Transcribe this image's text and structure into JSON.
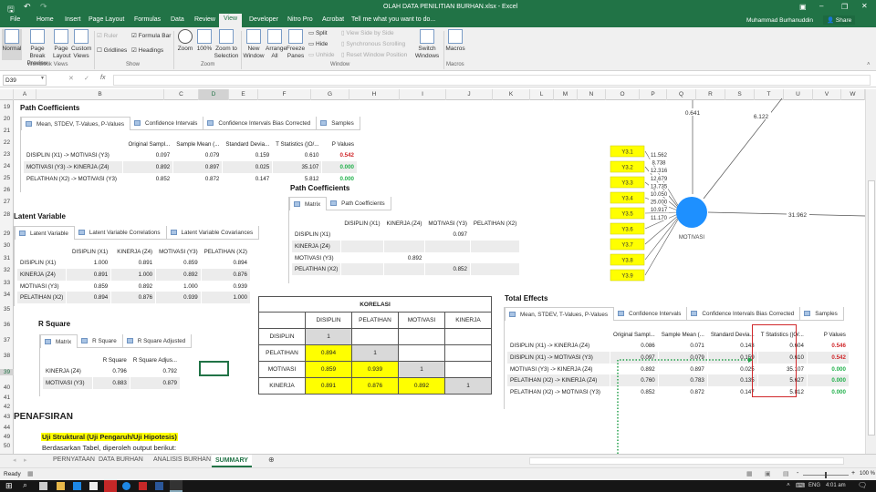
{
  "title": {
    "doc": "OLAH DATA PENILITIAN BURHAN.xlsx - Excel",
    "user": "Muhammad Burhanuddin",
    "share": "Share"
  },
  "ribbon_tabs": [
    "File",
    "Home",
    "Insert",
    "Page Layout",
    "Formulas",
    "Data",
    "Review",
    "View",
    "Developer",
    "Nitro Pro",
    "Acrobat",
    "Tell me what you want to do..."
  ],
  "ribbon": {
    "normal": "Normal",
    "page_break": "Page Break Preview",
    "page_layout": "Page Layout",
    "custom_views": "Custom Views",
    "workbook_views": "Workbook Views",
    "ruler": "Ruler",
    "formula_bar": "Formula Bar",
    "gridlines": "Gridlines",
    "headings": "Headings",
    "show": "Show",
    "zoom": "Zoom",
    "hundred": "100%",
    "zoom_sel": "Zoom to Selection",
    "zoom_group": "Zoom",
    "new_window": "New Window",
    "arrange_all": "Arrange All",
    "freeze": "Freeze Panes",
    "split": "Split",
    "hide": "Hide",
    "unhide": "Unhide",
    "side_by_side": "View Side by Side",
    "sync_scroll": "Synchronous Scrolling",
    "reset_pos": "Reset Window Position",
    "switch": "Switch Windows",
    "window_group": "Window",
    "macros": "Macros",
    "macros_group": "Macros"
  },
  "formula_bar": {
    "name_box": "D39",
    "value": ""
  },
  "columns": [
    "A",
    "B",
    "C",
    "D",
    "E",
    "F",
    "G",
    "H",
    "I",
    "J",
    "K",
    "L",
    "M",
    "N",
    "O",
    "P",
    "Q",
    "R",
    "S",
    "T",
    "U",
    "V",
    "W"
  ],
  "rows": [
    "19",
    "20",
    "21",
    "22",
    "23",
    "24",
    "25",
    "26",
    "27",
    "28",
    "29",
    "30",
    "31",
    "32",
    "33",
    "34",
    "35",
    "36",
    "37",
    "38",
    "39",
    "40",
    "41",
    "42",
    "43",
    "44",
    "49",
    "50"
  ],
  "path_coef": {
    "title": "Path Coefficients",
    "tabs": [
      "Mean, STDEV, T-Values, P-Values",
      "Confidence Intervals",
      "Confidence Intervals Bias Corrected",
      "Samples"
    ],
    "headers": [
      "",
      "Original Sampl...",
      "Sample Mean (...",
      "Standard Devia...",
      "T Statistics (|O/...",
      "P Values"
    ],
    "rows": [
      [
        "DISIPLIN (X1) -> MOTIVASI (Y3)",
        "0.097",
        "0.079",
        "0.159",
        "0.610",
        "0.542"
      ],
      [
        "MOTIVASI (Y3) -> KINERJA (Z4)",
        "0.892",
        "0.897",
        "0.025",
        "35.107",
        "0.000"
      ],
      [
        "PELATIHAN (X2) -> MOTIVASI (Y3)",
        "0.852",
        "0.872",
        "0.147",
        "5.812",
        "0.000"
      ]
    ]
  },
  "latent": {
    "title": "Latent Variable",
    "tabs": [
      "Latent Variable",
      "Latent Variable Correlations",
      "Latent Variable Covariances"
    ],
    "headers": [
      "",
      "DISIPLIN (X1)",
      "KINERJA (Z4)",
      "MOTIVASI (Y3)",
      "PELATIHAN (X2)"
    ],
    "rows": [
      [
        "DISIPLIN (X1)",
        "1.000",
        "0.891",
        "0.859",
        "0.894"
      ],
      [
        "KINERJA (Z4)",
        "0.891",
        "1.000",
        "0.892",
        "0.876"
      ],
      [
        "MOTIVASI (Y3)",
        "0.859",
        "0.892",
        "1.000",
        "0.939"
      ],
      [
        "PELATIHAN (X2)",
        "0.894",
        "0.876",
        "0.939",
        "1.000"
      ]
    ]
  },
  "path_matrix": {
    "title": "Path Coefficients",
    "tabs": [
      "Matrix",
      "Path Coefficients"
    ],
    "headers": [
      "",
      "DISIPLIN (X1)",
      "KINERJA (Z4)",
      "MOTIVASI (Y3)",
      "PELATIHAN (X2)"
    ],
    "rows": [
      [
        "DISIPLIN (X1)",
        "",
        "",
        "0.097",
        ""
      ],
      [
        "KINERJA (Z4)",
        "",
        "",
        "",
        ""
      ],
      [
        "MOTIVASI (Y3)",
        "",
        "0.892",
        "",
        ""
      ],
      [
        "PELATIHAN (X2)",
        "",
        "",
        "0.852",
        ""
      ]
    ]
  },
  "rsquare": {
    "title": "R Square",
    "tabs": [
      "Matrix",
      "R Square",
      "R Square Adjusted"
    ],
    "headers": [
      "",
      "R Square",
      "R Square Adjus..."
    ],
    "rows": [
      [
        "KINERJA (Z4)",
        "0.796",
        "0.792"
      ],
      [
        "MOTIVASI (Y3)",
        "0.883",
        "0.879"
      ]
    ]
  },
  "korelasi": {
    "title": "KORELASI",
    "headers": [
      "",
      "DISIPLIN",
      "PELATIHAN",
      "MOTIVASI",
      "KINERJA"
    ],
    "rows": [
      [
        "DISIPLIN",
        "1",
        "",
        "",
        ""
      ],
      [
        "PELATIHAN",
        "0.894",
        "1",
        "",
        ""
      ],
      [
        "MOTIVASI",
        "0.859",
        "0.939",
        "1",
        ""
      ],
      [
        "KINERJA",
        "0.891",
        "0.876",
        "0.892",
        "1"
      ]
    ]
  },
  "total_effects": {
    "title": "Total Effects",
    "tabs": [
      "Mean, STDEV, T-Values, P-Values",
      "Confidence Intervals",
      "Confidence Intervals Bias Corrected",
      "Samples"
    ],
    "headers": [
      "",
      "Original Sampl...",
      "Sample Mean (...",
      "Standard Devia...",
      "T Statistics (|O/...",
      "P Values"
    ],
    "rows": [
      [
        "DISIPLIN (X1) -> KINERJA (Z4)",
        "0.086",
        "0.071",
        "0.143",
        "0.604",
        "0.546"
      ],
      [
        "DISIPLIN (X1) -> MOTIVASI (Y3)",
        "0.097",
        "0.079",
        "0.159",
        "0.610",
        "0.542"
      ],
      [
        "MOTIVASI (Y3) -> KINERJA (Z4)",
        "0.892",
        "0.897",
        "0.025",
        "35.107",
        "0.000"
      ],
      [
        "PELATIHAN (X2) -> KINERJA (Z4)",
        "0.760",
        "0.783",
        "0.135",
        "5.627",
        "0.000"
      ],
      [
        "PELATIHAN (X2) -> MOTIVASI (Y3)",
        "0.852",
        "0.872",
        "0.147",
        "5.812",
        "0.000"
      ]
    ]
  },
  "diagram": {
    "construct": "MOTIVASI",
    "indicators": [
      "Y3.1",
      "Y3.2",
      "Y3.3",
      "Y3.4",
      "Y3.5",
      "Y3.6",
      "Y3.7",
      "Y3.8",
      "Y3.9"
    ],
    "loadings": [
      "11.562",
      "8.738",
      "12.316",
      "12.679",
      "13.735",
      "10.050",
      "25.000",
      "10.917",
      "11.170"
    ],
    "path_top": "0.641",
    "path_diag": "6.122",
    "path_right": "31.962",
    "circle_color": "#1e90ff",
    "box_color": "#ffff00"
  },
  "text": {
    "penafsiran": "PENAFSIRAN",
    "uji": "Uji Struktural (Uji Pengaruh/Uji Hipotesis)",
    "berdasarkan": "Berdasarkan Tabel, diperoleh output berikut:"
  },
  "sheets": [
    "PERNYATAAN",
    "DATA BURHAN",
    "ANALISIS BURHAN",
    "SUMMARY"
  ],
  "status": {
    "ready": "Ready",
    "zoom": "100 %"
  },
  "taskbar": {
    "lang": "ENG",
    "time": "4:01 am"
  }
}
